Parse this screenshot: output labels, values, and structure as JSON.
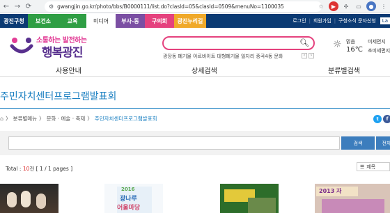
{
  "browser": {
    "url": "gwangjin.go.kr/photo/bbs/B0000111/list.do?clasId=05&clasId=0509&menuNo=1100035"
  },
  "topbar": {
    "tabs": [
      {
        "label": "광진구청",
        "bg": "#0b3a73"
      },
      {
        "label": "보건소",
        "bg": "#2f9e44"
      },
      {
        "label": "교육",
        "bg": "#2f9e44"
      },
      {
        "label": "미디어",
        "bg": "#ffffff"
      },
      {
        "label": "부사-동",
        "bg": "#7b4fa3"
      },
      {
        "label": "구의회",
        "bg": "#e5427e"
      },
      {
        "label": "광진누리길",
        "bg": "#f0a92a"
      }
    ],
    "util": [
      "로그인",
      "회원가입",
      "구청소식 문자신청",
      "La"
    ]
  },
  "header": {
    "logo_small": "소통하는 발전하는",
    "logo_big": "행복광진",
    "keywords": "광장동  폐기물  아르바이트  대형폐기물  일자리  중곡4동  문화",
    "weather_cond": "맑음",
    "weather_temp": "16℃",
    "dust1": "미세먼지",
    "dust2": "초미세먼지"
  },
  "gnb": [
    "사용안내",
    "상세검색",
    "분류별검색"
  ],
  "page": {
    "title": "주민자치센터프로그램발표회",
    "breadcrumb": [
      "분류별메뉴",
      "문화 · 예술 · 축제",
      "주민자치센터프로그램발표회"
    ],
    "search_btn": "검색",
    "search_btn2": "전체",
    "total_label": "Total : ",
    "total_count": "10",
    "total_unit": "건 [ 1 / 1 pages ]",
    "sort_label": "제목"
  },
  "thumbs": [
    {
      "text": ""
    },
    {
      "text": "2016\n광나루\n어울마당"
    },
    {
      "text": ""
    },
    {
      "text": "2013 자"
    }
  ],
  "colors": {
    "navy": "#0b3a73",
    "accent_blue": "#1a7fc1",
    "pink": "#e5427e"
  }
}
